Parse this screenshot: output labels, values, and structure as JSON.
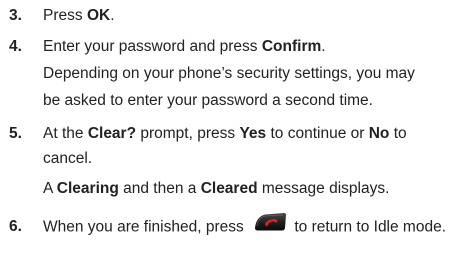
{
  "steps": [
    {
      "number": "3.",
      "lines": [
        [
          "Press ",
          "OK",
          "."
        ]
      ]
    },
    {
      "number": "4.",
      "lines": [
        [
          "Enter your password and press ",
          "Confirm",
          "."
        ],
        [
          "Depending on your phone’s security settings, you may"
        ],
        [
          "be asked to enter your password a second time."
        ]
      ]
    },
    {
      "number": "5.",
      "lines": [
        [
          "At the ",
          "Clear?",
          " prompt, press ",
          "Yes",
          " to continue or ",
          "No",
          " to"
        ],
        [
          "cancel."
        ],
        [
          "A ",
          "Clearing",
          " and then a ",
          "Cleared",
          " message displays."
        ]
      ]
    },
    {
      "number": "6.",
      "lines": [
        [
          "When you are finished, press ",
          " to return to Idle mode."
        ]
      ],
      "icon": "end-call-key-icon"
    }
  ]
}
